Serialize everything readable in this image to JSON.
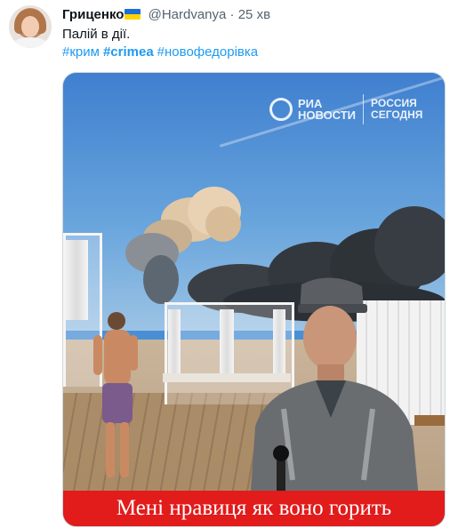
{
  "tweet": {
    "author_name": "Гриценко",
    "handle": "@Hardvanya",
    "separator": "·",
    "time": "25 хв",
    "text": "Палій в дії.",
    "hashtags": [
      {
        "text": "#крим",
        "bold": false
      },
      {
        "text": "#crimea",
        "bold": true
      },
      {
        "text": "#новофедорівка",
        "bold": false
      }
    ]
  },
  "media": {
    "logo": {
      "brand_line1": "РИА",
      "brand_line2": "НОВОСТИ",
      "partner_line1": "РОССИЯ",
      "partner_line2": "СЕГОДНЯ"
    },
    "caption": "Мені нравиця як воно горить"
  },
  "colors": {
    "link": "#1d9bf0",
    "muted": "#536471",
    "caption_bg": "#e21b1b",
    "flag_blue": "#1d6fd6",
    "flag_yellow": "#ffd500"
  },
  "icons": [
    "avatar",
    "ukraine-flag-icon",
    "ria-logo-icon"
  ]
}
